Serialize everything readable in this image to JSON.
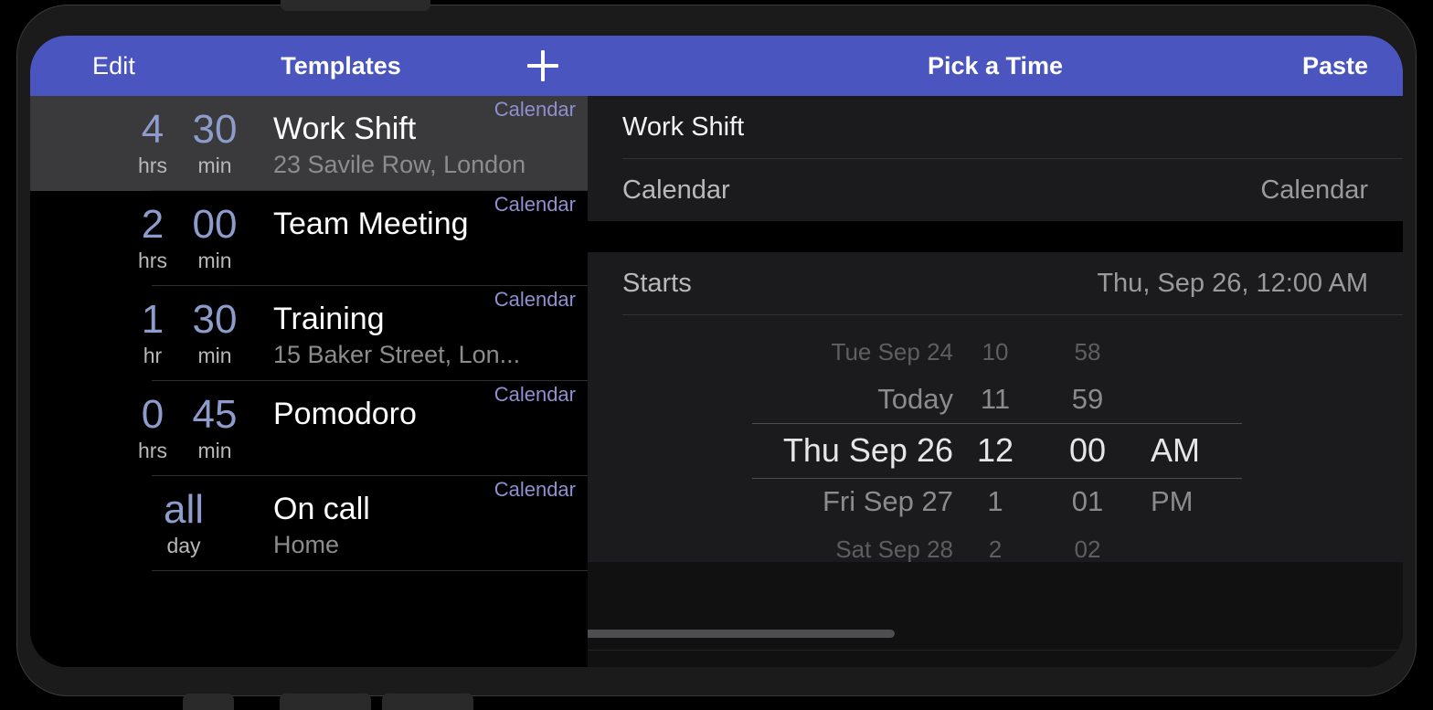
{
  "left_panel": {
    "nav": {
      "edit_label": "Edit",
      "title": "Templates",
      "add_icon": "plus-icon"
    },
    "templates": [
      {
        "num1": "4",
        "unit1": "hrs",
        "num2": "30",
        "unit2": "min",
        "title": "Work Shift",
        "subtitle": "23 Savile Row, London",
        "calendar": "Calendar",
        "selected": true,
        "allday": false
      },
      {
        "num1": "2",
        "unit1": "hrs",
        "num2": "00",
        "unit2": "min",
        "title": "Team Meeting",
        "subtitle": "",
        "calendar": "Calendar",
        "selected": false,
        "allday": false
      },
      {
        "num1": "1",
        "unit1": "hr",
        "num2": "30",
        "unit2": "min",
        "title": "Training",
        "subtitle": "15 Baker Street, Lon...",
        "calendar": "Calendar",
        "selected": false,
        "allday": false
      },
      {
        "num1": "0",
        "unit1": "hrs",
        "num2": "45",
        "unit2": "min",
        "title": "Pomodoro",
        "subtitle": "",
        "calendar": "Calendar",
        "selected": false,
        "allday": false
      },
      {
        "num1": "all",
        "unit1": "day",
        "num2": "",
        "unit2": "",
        "title": "On call",
        "subtitle": "Home",
        "calendar": "Calendar",
        "selected": false,
        "allday": true
      }
    ]
  },
  "right_panel": {
    "nav": {
      "title": "Pick a Time",
      "paste_label": "Paste"
    },
    "event_title": "Work Shift",
    "calendar_row": {
      "label": "Calendar",
      "value": "Calendar"
    },
    "starts_row": {
      "label": "Starts",
      "value": "Thu, Sep 26, 12:00 AM"
    },
    "picker": {
      "rows": [
        {
          "date": "Tue Sep 24",
          "hour": "10",
          "minute": "58",
          "ampm": "",
          "style": "far"
        },
        {
          "date": "Today",
          "hour": "11",
          "minute": "59",
          "ampm": "",
          "style": "near"
        },
        {
          "date": "Thu Sep 26",
          "hour": "12",
          "minute": "00",
          "ampm": "AM",
          "style": "selected"
        },
        {
          "date": "Fri Sep 27",
          "hour": "1",
          "minute": "01",
          "ampm": "PM",
          "style": "near"
        },
        {
          "date": "Sat Sep 28",
          "hour": "2",
          "minute": "02",
          "ampm": "",
          "style": "far"
        }
      ]
    }
  },
  "colors": {
    "nav_blue": "#4a55c0",
    "accent_lavender": "#8e9ccb",
    "calendar_tag": "#8e8fd0",
    "selected_row_bg": "#3a3a3c",
    "panel_bg": "#1b1b1d"
  }
}
